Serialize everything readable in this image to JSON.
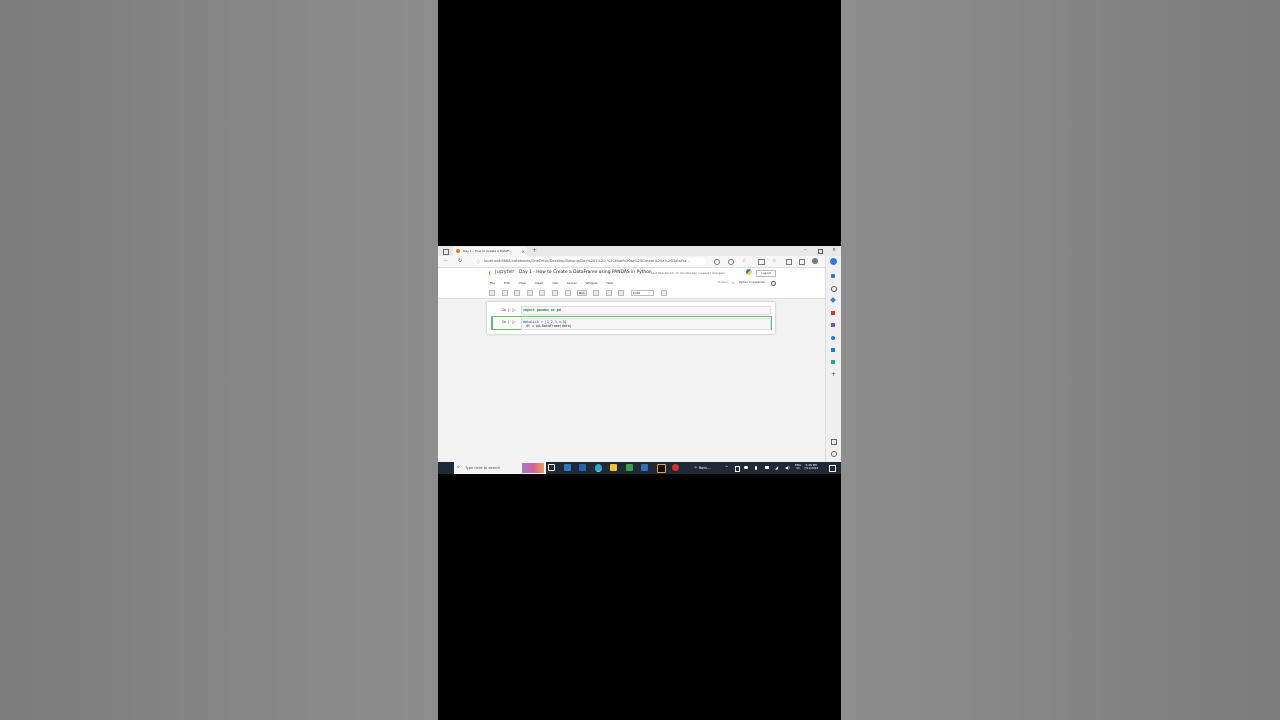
{
  "browser": {
    "tab_title": "Day 1 - How to Create a DataFr...",
    "new_tab_symbol": "+",
    "url": "localhost:8888/notebooks/OneDrive/Desktop/Sakong/Day%201%20-%20How%20to%20Create%20a%20DataFra..."
  },
  "jupyter": {
    "logo_text": "jupyter",
    "notebook_title": "Day 1 - How to Create a DataFrame using PANDAS in Python",
    "checkpoint": "Last Checkpoint: 13 minutes ago (unsaved changes)",
    "logout_label": "Logout",
    "trusted_label": "Trusted",
    "kernel_label": "Python 3 (ipykernel)",
    "menu": [
      "File",
      "Edit",
      "View",
      "Insert",
      "Cell",
      "Kernel",
      "Widgets",
      "Help"
    ],
    "run_label": "Run",
    "cell_type": "Code"
  },
  "cells": [
    {
      "prompt": "In [ ]:",
      "line1": "import pandas as pd",
      "line2": ""
    },
    {
      "prompt": "In [ ]:",
      "line1": "dataList = [1,2,3,4,5]",
      "line2": "df = pd.DataFrame(data)"
    }
  ],
  "taskbar": {
    "search_placeholder": "Type here to search",
    "app_label": "Rain...",
    "lang_line1": "ENG",
    "lang_line2": "IN",
    "time": "5:48 PM",
    "date": "7/11/2023"
  },
  "colors": {
    "jupyter_orange": "#f37726",
    "taskbar_bg": "#1f2a36",
    "cell_selected_border": "#66bb6a"
  }
}
